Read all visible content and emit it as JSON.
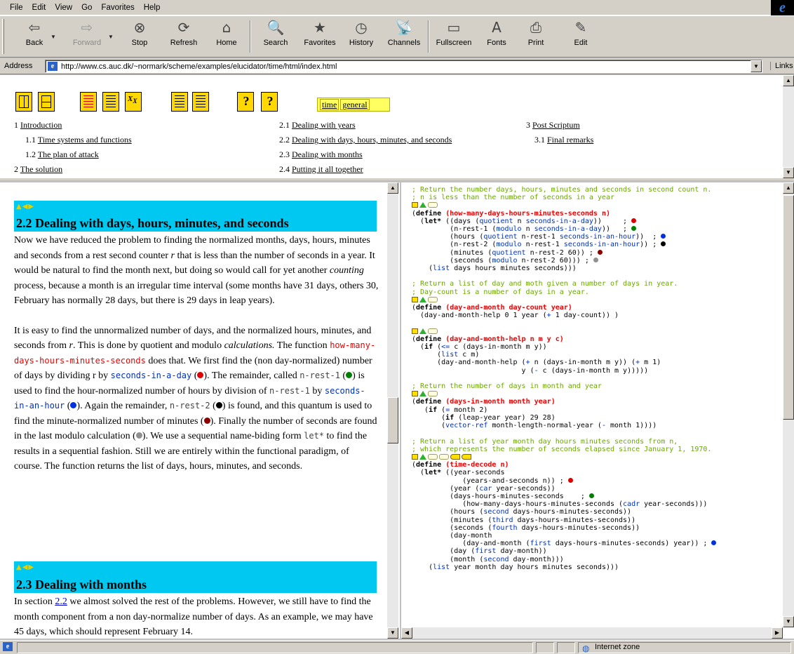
{
  "menubar": {
    "items": [
      "File",
      "Edit",
      "View",
      "Go",
      "Favorites",
      "Help"
    ]
  },
  "toolbar": {
    "buttons": [
      {
        "label": "Back",
        "icon": "back-arrow-icon",
        "glyph": "⇦"
      },
      {
        "label": "Forward",
        "icon": "forward-arrow-icon",
        "glyph": "⇨"
      },
      {
        "label": "Stop",
        "icon": "stop-icon",
        "glyph": "⊗"
      },
      {
        "label": "Refresh",
        "icon": "refresh-icon",
        "glyph": "⟳"
      },
      {
        "label": "Home",
        "icon": "home-icon",
        "glyph": "⌂"
      },
      {
        "label": "Search",
        "icon": "search-icon",
        "glyph": "🔍"
      },
      {
        "label": "Favorites",
        "icon": "favorites-icon",
        "glyph": "★"
      },
      {
        "label": "History",
        "icon": "history-icon",
        "glyph": "◷"
      },
      {
        "label": "Channels",
        "icon": "channels-icon",
        "glyph": "📡"
      },
      {
        "label": "Fullscreen",
        "icon": "fullscreen-icon",
        "glyph": "▭"
      },
      {
        "label": "Fonts",
        "icon": "fonts-icon",
        "glyph": "A"
      },
      {
        "label": "Print",
        "icon": "print-icon",
        "glyph": "⎙"
      },
      {
        "label": "Edit",
        "icon": "edit-icon",
        "glyph": "✎"
      }
    ]
  },
  "address": {
    "label": "Address",
    "url": "http://www.cs.auc.dk/~normark/scheme/examples/elucidator/time/html/index.html",
    "links_label": "Links"
  },
  "topframe": {
    "context_links": [
      "time",
      "general"
    ],
    "toc_col1": [
      {
        "num": "1",
        "title": "Introduction"
      },
      {
        "num": "1.1",
        "title": "Time systems and functions"
      },
      {
        "num": "1.2",
        "title": "The plan of attack"
      },
      {
        "num": "2",
        "title": "The solution"
      }
    ],
    "toc_col2": [
      {
        "num": "2.1",
        "title": "Dealing with years"
      },
      {
        "num": "2.2",
        "title": "Dealing with days, hours, minutes, and seconds"
      },
      {
        "num": "2.3",
        "title": "Dealing with months"
      },
      {
        "num": "2.4",
        "title": "Putting it all together"
      }
    ],
    "toc_col3": [
      {
        "num": "3",
        "title": "Post Scriptum"
      },
      {
        "num": "3.1",
        "title": "Final remarks"
      }
    ]
  },
  "left": {
    "section22_title": "2.2  Dealing with days, hours, minutes, and seconds",
    "section23_title": "2.3  Dealing with months",
    "p1": {
      "t1": "Now we have reduced the problem to finding the normalized months, days, hours, minutes and seconds from a rest second counter ",
      "r": "r",
      "t2": " that is less than the number of seconds in a year. It would be natural to find the month next, but doing so would call for yet another ",
      "counting": "counting",
      "t3": " process, because a month is an irregular time interval (some months have 31 days, others 30, February has normally 28 days, but there is 29 days in leap years)."
    },
    "p2": {
      "t1": "It is easy to find the unnormalized number of days, and the normalized hours, minutes, and seconds from ",
      "r": "r",
      "t2": ". This is done by quotient and modulo ",
      "calc": "calculations.",
      "t3": " The function ",
      "fn": "how-many-days-hours-minutes-seconds",
      "t4": " does that. We first find the (non day-normalized) number of days by dividing r by ",
      "sid": "seconds-in-a-day",
      "t5": " (",
      "t6": "). The remainder, called ",
      "nr1": "n-rest-1",
      "t7": " (",
      "t8": ") is used to find the hour-normalized number of hours by division of ",
      "nr1b": "n-rest-1",
      "t9": " by ",
      "sih": "seconds-in-an-hour",
      "t10": " (",
      "t11": "). Again the remainder, ",
      "nr2": "n-rest-2",
      "t12": " (",
      "t13": ") is found, and this quantum is used to find the minute-normalized number of minutes (",
      "t14": "). Finally the number of seconds are found in the last modulo calculation (",
      "t15": "). We use a sequential name-biding form ",
      "let": "let*",
      "t16": " to find the results in a sequential fashion. Still we are entirely within the functional paradigm, of course. The function returns the list of days, hours, minutes, and seconds."
    },
    "p3": {
      "t1": "In section ",
      "link": "2.2",
      "t2": " we almost solved the rest of the problems. However, we still have to find the month component from a non day-normalize number of days. As an example, we may have 45 days, which should represent February 14."
    }
  },
  "colors": {
    "dot_red": "#e00000",
    "dot_green": "#008000",
    "dot_blue": "#0030e0",
    "dot_black": "#000000",
    "dot_gray": "#909090",
    "section_bg": "#00c8f0",
    "comment": "#6ba800"
  },
  "status": {
    "zone": "Internet zone"
  }
}
